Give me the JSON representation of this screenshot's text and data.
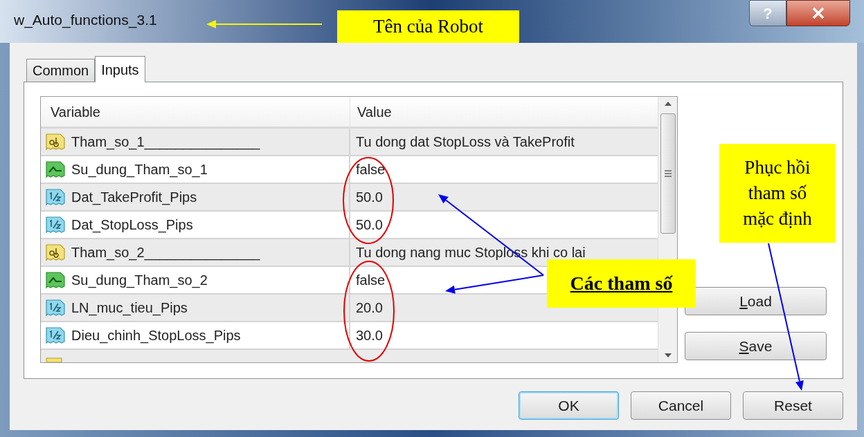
{
  "window": {
    "title": "w_Auto_functions_3.1",
    "help": "?"
  },
  "tabs": [
    {
      "label": "Common",
      "selected": false
    },
    {
      "label": "Inputs",
      "selected": true
    }
  ],
  "table": {
    "columns": [
      "Variable",
      "Value"
    ],
    "rows": [
      {
        "kind": "string",
        "variable": "Tham_so_1_______________",
        "value": "Tu dong dat StopLoss và TakeProfit"
      },
      {
        "kind": "bool",
        "variable": "Su_dung_Tham_so_1",
        "value": "false"
      },
      {
        "kind": "double",
        "variable": "Dat_TakeProfit_Pips",
        "value": "50.0"
      },
      {
        "kind": "double",
        "variable": "Dat_StopLoss_Pips",
        "value": "50.0"
      },
      {
        "kind": "string",
        "variable": "Tham_so_2_______________",
        "value": "Tu dong nang muc Stoploss khi co lai"
      },
      {
        "kind": "bool",
        "variable": "Su_dung_Tham_so_2",
        "value": "false"
      },
      {
        "kind": "double",
        "variable": "LN_muc_tieu_Pips",
        "value": "20.0"
      },
      {
        "kind": "double",
        "variable": "Dieu_chinh_StopLoss_Pips",
        "value": "30.0"
      }
    ]
  },
  "side_buttons": [
    {
      "label": "Load",
      "mnemonic": true
    },
    {
      "label": "Save",
      "mnemonic": true
    }
  ],
  "footer_buttons": [
    {
      "label": "OK",
      "default": true
    },
    {
      "label": "Cancel",
      "default": false
    },
    {
      "label": "Reset",
      "default": false
    }
  ],
  "annotations": [
    {
      "text": "Tên của Robot"
    },
    {
      "text": "Phục hồi tham số mặc định"
    },
    {
      "text": "Các tham số"
    }
  ]
}
